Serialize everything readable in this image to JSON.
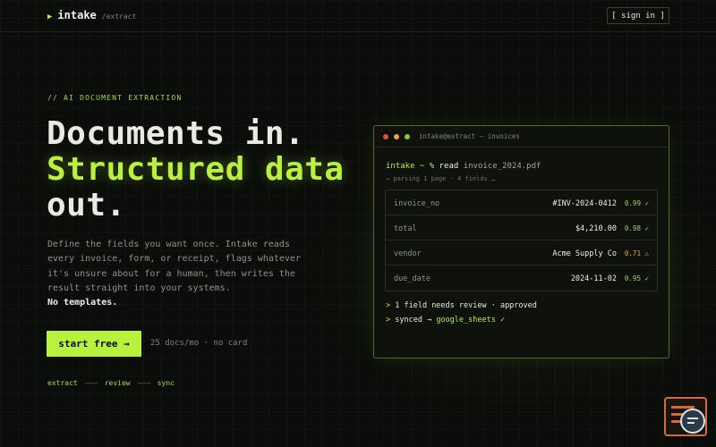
{
  "header": {
    "brand_name": "intake",
    "brand_sub": "/extract",
    "signin_label": "[ sign in ]"
  },
  "hero": {
    "eyebrow": "// AI DOCUMENT EXTRACTION",
    "headline_line1": "Documents in.",
    "headline_line2": "Structured data",
    "headline_line3": "out.",
    "description": "Define the fields you want once. Intake reads every invoice, form, or receipt, flags whatever it's unsure about for a human, then writes the result straight into your systems.",
    "description_strong": "No templates.",
    "cta_label": "start free →",
    "cta_note": "25 docs/mo · no card",
    "steps": [
      "extract",
      "review",
      "sync"
    ]
  },
  "terminal": {
    "title": "intake@extract — invoices",
    "prompt": "intake ~ %",
    "command": "read",
    "argument": "invoice_2024.pdf",
    "parsing": "→ parsing 1 page · 4 fields …",
    "fields": [
      {
        "key": "invoice_no",
        "value": "#INV-2024-0412",
        "confidence": "0.99 ✓",
        "status": "ok"
      },
      {
        "key": "total",
        "value": "$4,210.00",
        "confidence": "0.98 ✓",
        "status": "ok"
      },
      {
        "key": "vendor",
        "value": "Acme Supply Co",
        "confidence": "0.71 ⚠",
        "status": "warn"
      },
      {
        "key": "due_date",
        "value": "2024-11-02",
        "confidence": "0.95 ✓",
        "status": "ok"
      }
    ],
    "log1": "1 field needs review · approved",
    "log2_prefix": "synced →",
    "log2_target": "google_sheets ✓"
  },
  "colors": {
    "accent": "#b8f23f",
    "warning": "#e4a63a",
    "background": "#0b0d0a"
  }
}
